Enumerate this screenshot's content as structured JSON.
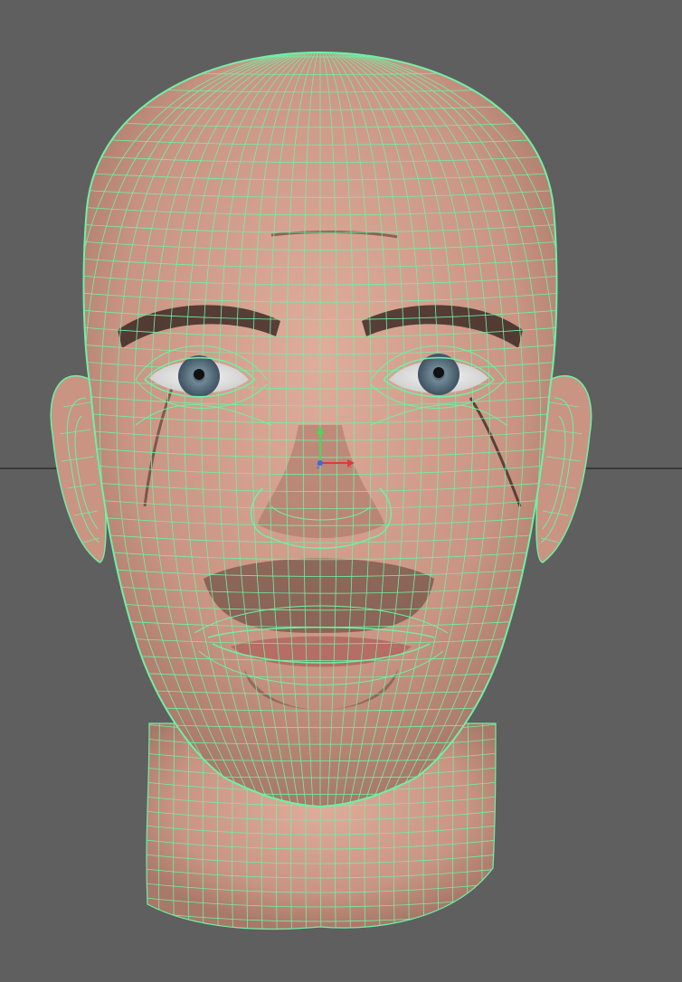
{
  "viewport": {
    "background_color": "#5f5f5f",
    "wireframe_color": "#6ff0a6",
    "skin_color": "#d9a390",
    "horizon_line_color": "#3a3a3a",
    "display_mode": "wireframe-on-shaded",
    "camera_view": "front"
  },
  "model": {
    "subject": "human head",
    "selected": true
  },
  "gizmo": {
    "axes": [
      "y",
      "z",
      "x"
    ],
    "colors": {
      "x": "#e03a3a",
      "y": "#3ae05a",
      "z": "#3a6ae0"
    }
  }
}
